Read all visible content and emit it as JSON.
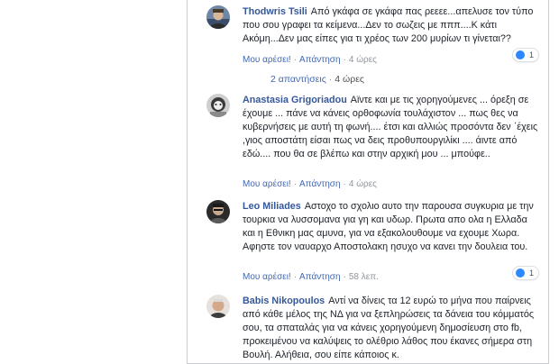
{
  "comments": [
    {
      "author": "Thodwris Tsili",
      "text": "Από γκάφα σε γκάφα πας ρεεεε...απελυσε τον τύπο που σου γραφει τα κείμενα...Δεν το σωζεις με πππ....Κ κάτι Ακόμη...Δεν μας είπες για τι χρέος των 200 μυρίων τι γίνεται??",
      "like": "Μου αρέσει!",
      "reply": "Απάντηση",
      "time": "4 ώρες",
      "reaction_count": "1"
    },
    {
      "author": "Anastasia Grigoriadou",
      "text": "Αϊντε και με τις χορηγούμενες ... όρεξη σε έχουμε ... πάνε να κάνεις ορθοφωνία τουλάχιστον ... πως θες να κυβερνήσεις με αυτή τη φωνή.... έτσι και αλλιώς προσόντα δεν ΄έχεις ,γιος αποστάτη είσαι πως να δεις προθυπουργιλίκι .... άιντε από εδώ.... που θα σε βλέπω και στην αρχική μου ... μπούφε..",
      "like": "Μου αρέσει!",
      "reply": "Απάντηση",
      "time": "4 ώρες"
    },
    {
      "author": "Leo Miliades",
      "text": "Αστοχο το σχολιο αυτο την παρουσα συγκυρια με την τουρκια να λυσσομανα για γη και υδωρ. Πρωτα απο ολα η Ελλαδα και η Εθνικη μας αμυνα, για να εξακολουθουμε να εχουμε Χωρα. Αφηστε τον ναυαρχο Αποστολακη ησυχο να κανει την δουλεια του.",
      "like": "Μου αρέσει!",
      "reply": "Απάντηση",
      "time": "58 λεπ.",
      "reaction_count": "1"
    },
    {
      "author": "Babis Nikopoulos",
      "text": "Αντί να δίνεις τα 12 ευρώ το μήνα που παίρνεις από κάθε μέλος της ΝΔ για να ξεπληρώσεις τα δάνεια του κόμματός σου, τα σπαταλάς για να κάνεις χορηγούμενη δημοσίευση στο fb, προκειμένου να καλύψεις το ολέθριο λάθος που έκανες σήμερα στη Βουλή. Αλήθεια, σου είπε κάποιος κ."
    }
  ],
  "replies_link": {
    "label": "2 απαντήσεις",
    "time": "4 ώρες"
  },
  "colors": {
    "author": "#365899",
    "link": "#4267b2",
    "text": "#1d2129",
    "like_blue": "#2d88ff"
  }
}
